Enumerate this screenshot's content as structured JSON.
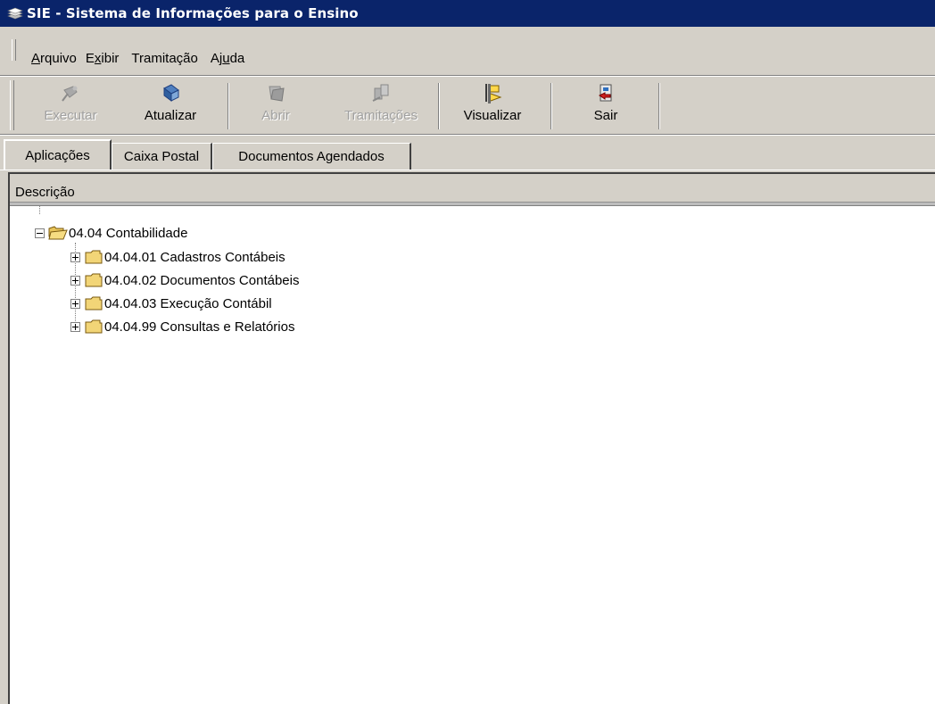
{
  "window": {
    "title": "SIE - Sistema de Informações para o Ensino",
    "app_icon": "books-icon"
  },
  "menu": [
    {
      "pre": "",
      "key": "A",
      "post": "rquivo"
    },
    {
      "pre": "E",
      "key": "x",
      "post": "ibir"
    },
    {
      "pre": "Tramitação",
      "key": "",
      "post": ""
    },
    {
      "pre": "Aj",
      "key": "u",
      "post": "da"
    }
  ],
  "toolbar": {
    "executar": {
      "label": "Executar",
      "icon": "run-icon",
      "enabled": false
    },
    "atualizar": {
      "label": "Atualizar",
      "icon": "refresh-icon",
      "enabled": true
    },
    "abrir": {
      "label": "Abrir",
      "icon": "open-icon",
      "enabled": false
    },
    "tramitacoes": {
      "label": "Tramitações",
      "icon": "transfer-icon",
      "enabled": false
    },
    "visualizar": {
      "label": "Visualizar",
      "icon": "preview-icon",
      "enabled": true
    },
    "sair": {
      "label": "Sair",
      "icon": "exit-icon",
      "enabled": true
    }
  },
  "tabs": [
    {
      "label": "Aplicações",
      "active": true
    },
    {
      "label": "Caixa Postal",
      "active": false
    },
    {
      "label": "Documentos Agendados",
      "active": false
    }
  ],
  "grid": {
    "column_header": "Descrição",
    "tree": {
      "root": {
        "label": "04.04 Contabilidade",
        "expanded": true
      },
      "children": [
        {
          "label": "04.04.01 Cadastros Contábeis",
          "expanded": false
        },
        {
          "label": "04.04.02 Documentos Contábeis",
          "expanded": false
        },
        {
          "label": "04.04.03 Execução Contábil",
          "expanded": false
        },
        {
          "label": "04.04.99 Consultas e Relatórios",
          "expanded": false
        }
      ]
    }
  }
}
